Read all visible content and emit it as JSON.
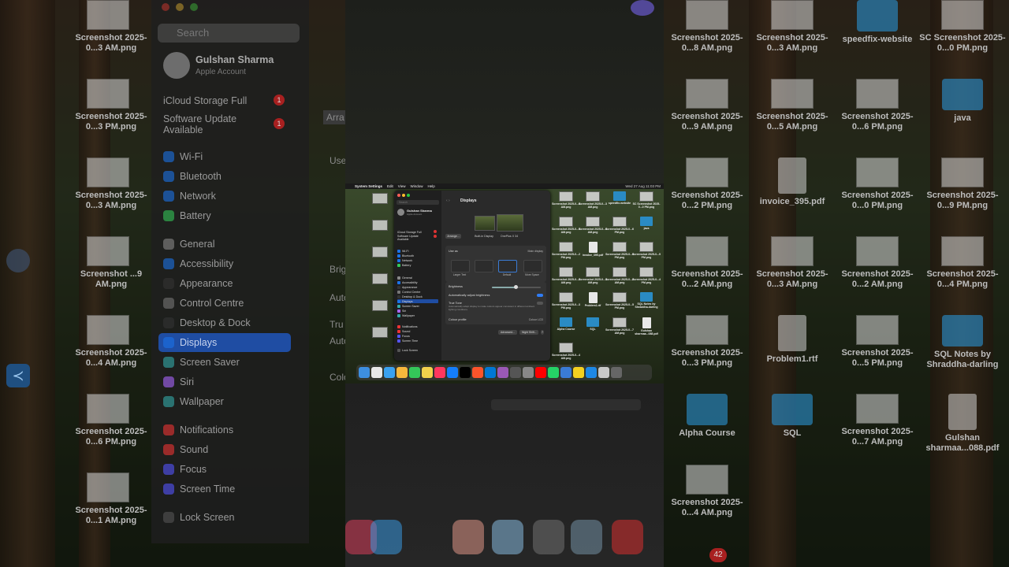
{
  "left_blurred": {
    "search_placeholder": "Search",
    "account_name": "Gulshan Sharma",
    "account_sub": "Apple Account",
    "icloud": "iCloud Storage Full",
    "icloud_badge": "1",
    "software_update": "Software Update Available",
    "software_update_badge": "1",
    "items": [
      "Wi-Fi",
      "Bluetooth",
      "Network",
      "Battery",
      "General",
      "Accessibility",
      "Appearance",
      "Control Centre",
      "Desktop & Dock",
      "Displays",
      "Screen Saver",
      "Siri",
      "Wallpaper",
      "Notifications",
      "Sound",
      "Focus",
      "Screen Time",
      "Lock Screen"
    ],
    "left_desk": [
      "Screenshot 2025-0...3 AM.png",
      "Screenshot 2025-0...3 PM.png",
      "Screenshot 2025-0...3 AM.png",
      "Screenshot ...9 AM.png",
      "Screenshot 2025-0...4 AM.png",
      "Screenshot 2025-0...6 PM.png",
      "Screenshot 2025-0...1 AM.png"
    ],
    "fragments": [
      "Arra",
      "Use",
      "Brig",
      "Auto",
      "Tru",
      "Auto ambi",
      "Colo"
    ]
  },
  "right_desktop": {
    "icons": [
      {
        "label": "Screenshot 2025-0...8 AM.png",
        "kind": "thumb"
      },
      {
        "label": "Screenshot 2025-0...3 AM.png",
        "kind": "thumb"
      },
      {
        "label": "speedfix-website",
        "kind": "folder"
      },
      {
        "label": "SC Screenshot 2025-0...0 PM.png",
        "kind": "thumb"
      },
      {
        "label": "Screenshot 2025-0...9 AM.png",
        "kind": "thumb"
      },
      {
        "label": "Screenshot 2025-0...5 AM.png",
        "kind": "thumb"
      },
      {
        "label": "Screenshot 2025-0...6 PM.png",
        "kind": "thumb"
      },
      {
        "label": "java",
        "kind": "folder"
      },
      {
        "label": "Screenshot 2025-0...2 PM.png",
        "kind": "thumb"
      },
      {
        "label": "invoice_395.pdf",
        "kind": "doc"
      },
      {
        "label": "Screenshot 2025-0...0 PM.png",
        "kind": "thumb"
      },
      {
        "label": "Screenshot 2025-0...9 PM.png",
        "kind": "thumb"
      },
      {
        "label": "Screenshot 2025-0...2 AM.png",
        "kind": "thumb"
      },
      {
        "label": "Screenshot 2025-0...3 AM.png",
        "kind": "thumb"
      },
      {
        "label": "Screenshot 2025-0...2 AM.png",
        "kind": "thumb"
      },
      {
        "label": "Screenshot 2025-0...4 PM.png",
        "kind": "thumb"
      },
      {
        "label": "Screenshot 2025-0...3 PM.png",
        "kind": "thumb"
      },
      {
        "label": "Problem1.rtf",
        "kind": "doc"
      },
      {
        "label": "Screenshot 2025-0...5 PM.png",
        "kind": "thumb"
      },
      {
        "label": "SQL Notes by Shraddha-darling",
        "kind": "folder"
      },
      {
        "label": "Alpha Course",
        "kind": "folder"
      },
      {
        "label": "SQL",
        "kind": "folder"
      },
      {
        "label": "Screenshot 2025-0...7 AM.png",
        "kind": "thumb"
      },
      {
        "label": "Gulshan sharmaa...088.pdf",
        "kind": "doc"
      },
      {
        "label": "Screenshot 2025-0...4 AM.png",
        "kind": "thumb"
      }
    ],
    "dock_badge": "42"
  },
  "mini_screen": {
    "menubar": {
      "apple": "",
      "app": "System Settings",
      "menus": [
        "Edit",
        "View",
        "Window",
        "Help"
      ],
      "datetime": "Wed 27 Aug  11:03 PM"
    },
    "settings": {
      "search_placeholder": "Search",
      "account_name": "Gulshan Sharma",
      "account_sub": "Apple Account",
      "icloud": "iCloud Storage Full",
      "software_update": "Software Update Available",
      "items": [
        "Wi-Fi",
        "Bluetooth",
        "Network",
        "Battery",
        "General",
        "Accessibility",
        "Appearance",
        "Control Centre",
        "Desktop & Dock",
        "Displays",
        "Screen Saver",
        "Siri",
        "Wallpaper",
        "Notifications",
        "Sound",
        "Focus",
        "Screen Time",
        "Lock Screen"
      ],
      "title": "Displays",
      "arrange": "Arrange...",
      "display1": "Built-in Display",
      "display2": "OnePlus X 34",
      "use_as": "Use as",
      "use_as_value": "Main display",
      "res_options": [
        "Larger Text",
        "",
        "Default",
        "More Space"
      ],
      "brightness": "Brightness",
      "auto_brightness": "Automatically adjust brightness",
      "true_tone": "True Tone",
      "true_tone_desc": "Automatically adapt display to make colours appear consistent in different ambient lighting conditions.",
      "colour_profile": "Colour profile",
      "colour_profile_value": "Colour LCD",
      "advanced": "Advanced...",
      "night_shift": "Night Shift...",
      "help": "?"
    },
    "mini_desk": [
      {
        "label": "Screenshot 2025-0...6 AM.png",
        "kind": "thumb"
      },
      {
        "label": "Screenshot 2025-0...3 AM.png",
        "kind": "thumb"
      },
      {
        "label": "speedfix-website",
        "kind": "folder"
      },
      {
        "label": "SC Screenshot 2025-0...0 PM.png",
        "kind": "thumb"
      },
      {
        "label": "Screenshot 2025-0...9 AM.png",
        "kind": "thumb"
      },
      {
        "label": "Screenshot 2025-0...6 AM.png",
        "kind": "thumb"
      },
      {
        "label": "Screenshot 2025-0...6 PM.png",
        "kind": "thumb"
      },
      {
        "label": "java",
        "kind": "folder"
      },
      {
        "label": "Screenshot 2025-0...2 PM.png",
        "kind": "thumb"
      },
      {
        "label": "invoice_395.pdf",
        "kind": "doc"
      },
      {
        "label": "Screenshot 2025-0...0 PM.png",
        "kind": "thumb"
      },
      {
        "label": "Screenshot 2025-0...9 PM.png",
        "kind": "thumb"
      },
      {
        "label": "Screenshot 2025-0...2 AM.png",
        "kind": "thumb"
      },
      {
        "label": "Screenshot 2025-0...3 AM.png",
        "kind": "thumb"
      },
      {
        "label": "Screenshot 2025-0...2 AM.png",
        "kind": "thumb"
      },
      {
        "label": "Screenshot 2025-0...4 PM.png",
        "kind": "thumb"
      },
      {
        "label": "Screenshot 2025-0...3 PM.png",
        "kind": "thumb"
      },
      {
        "label": "Problem1.rtf",
        "kind": "doc"
      },
      {
        "label": "Screenshot 2025-0...5 PM.png",
        "kind": "thumb"
      },
      {
        "label": "SQL Notes by Shraddha-darling",
        "kind": "folder"
      },
      {
        "label": "Alpha Course",
        "kind": "folder"
      },
      {
        "label": "SQL",
        "kind": "folder"
      },
      {
        "label": "Screenshot 2025-0...7 AM.png",
        "kind": "thumb"
      },
      {
        "label": "Gulshan sharmaa...088.pdf",
        "kind": "doc"
      },
      {
        "label": "Screenshot 2025-0...4 AM.png",
        "kind": "thumb"
      }
    ],
    "dock_colors": [
      "#3d8ee0",
      "#e8e8e8",
      "#3aa1f0",
      "#f6b73c",
      "#34c759",
      "#f2d24c",
      "#ff375f",
      "#147efb",
      "#000000",
      "#fb542b",
      "#0078d4",
      "#9b59b6",
      "#555555",
      "#888888",
      "#ff0000",
      "#25d366",
      "#3a7bd5",
      "#f5d020",
      "#1e88e5",
      "#c8c8c8",
      "#666666"
    ]
  },
  "colors": {
    "accent": "#1f4da3",
    "badge": "#d33333"
  }
}
